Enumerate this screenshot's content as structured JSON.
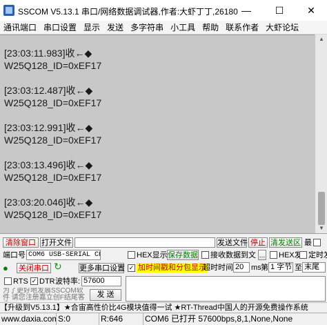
{
  "window": {
    "title": "SSCOM V5.13.1 串口/网络数据调试器,作者:大虾丁丁,26180",
    "min_glyph": "—",
    "max_glyph": "☐",
    "close_glyph": "✕"
  },
  "menu": [
    "通讯端口",
    "串口设置",
    "显示",
    "发送",
    "多字符串",
    "小工具",
    "帮助",
    "联系作者",
    "大虾论坛"
  ],
  "receive": {
    "entries": [
      {
        "header": "[23:03:11.983]收←◆",
        "data": "W25Q128_ID=0xEF17"
      },
      {
        "header": "[23:03:12.487]收←◆",
        "data": "W25Q128_ID=0xEF17"
      },
      {
        "header": "[23:03:12.991]收←◆",
        "data": "W25Q128_ID=0xEF17"
      },
      {
        "header": "[23:03:13.496]收←◆",
        "data": "W25Q128_ID=0xEF17"
      },
      {
        "header": "[23:03:20.046]收←◆",
        "data": "W25Q128_ID=0xEF17"
      }
    ]
  },
  "toolbar": {
    "clear_window": "清除窗口",
    "open_file": "打开文件",
    "send_file": "发送文件",
    "stop": "停止",
    "clear_send": "清发送区",
    "last_cut": "最",
    "english": "English"
  },
  "port": {
    "label": "端口号",
    "value": "COM6 USB-SERIAL CH340",
    "close_port": "关闭串口",
    "refresh_icon": "refresh-icon",
    "more_settings": "更多串口设置",
    "rts": "RTS",
    "dtr": "DTR",
    "baud_label": "波特率:",
    "baud_value": "57600"
  },
  "options": {
    "hex_display": "HEX显示",
    "save_data": "保存数据",
    "recv_to_file": "接收数据到文",
    "hex_send": "HEX发",
    "timed_send": "定时发",
    "timestamp": "加时间戳和分包显示",
    "timeout_label": "超时时间:",
    "timeout_value": "20",
    "timeout_unit": "ms",
    "byte_label": "第",
    "byte_value": "1 字节",
    "byte_to": "至",
    "byte_end": "末尾"
  },
  "send": {
    "notice": "为了更好地发展SSCOM软件 请您注册嘉立创F结尾客户",
    "send_button": "发 送"
  },
  "ad": "【升级到V5.13.1】★合宙高性价比4G模块值得一试 ★RT-Thread中国人的开源免费操作系统",
  "status": {
    "site": "www.daxia.com",
    "s": "S:0",
    "r": "R:646",
    "port_status": "COM6 已打开 57600bps,8,1,None,None"
  }
}
